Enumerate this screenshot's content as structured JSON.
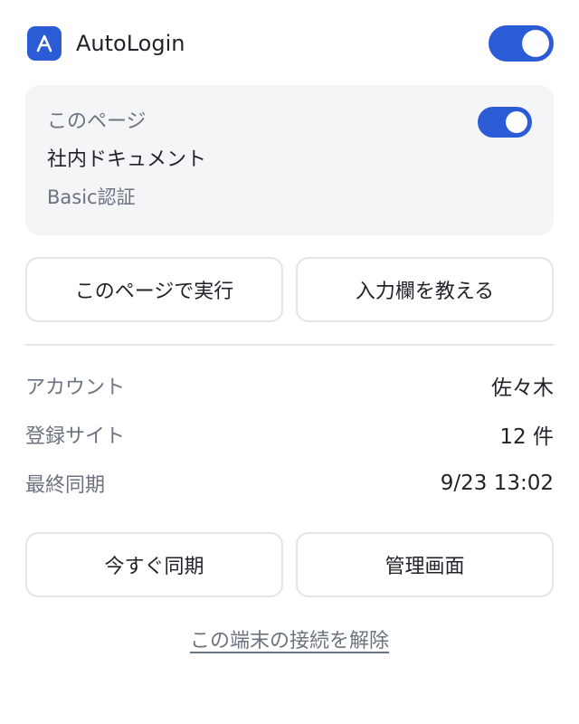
{
  "header": {
    "app_name": "AutoLogin",
    "logo_icon": "autologin-a-logo-icon",
    "enabled": true
  },
  "current_page": {
    "label": "このページ",
    "site_name": "社内ドキュメント",
    "auth_type": "Basic認証",
    "enabled": true
  },
  "actions": {
    "run_on_page": "このページで実行",
    "teach_fields": "入力欄を教える"
  },
  "info": {
    "account_label": "アカウント",
    "account_value": "佐々木",
    "sites_label": "登録サイト",
    "sites_value": "12 件",
    "last_sync_label": "最終同期",
    "last_sync_value": "9/23 13:02"
  },
  "footer_actions": {
    "sync_now": "今すぐ同期",
    "admin": "管理画面"
  },
  "disconnect_label": "この端末の接続を解除",
  "colors": {
    "accent": "#2b5cd6",
    "card_bg": "#f4f5f7",
    "muted_text": "#6b7280",
    "border": "#e3e5e8"
  }
}
